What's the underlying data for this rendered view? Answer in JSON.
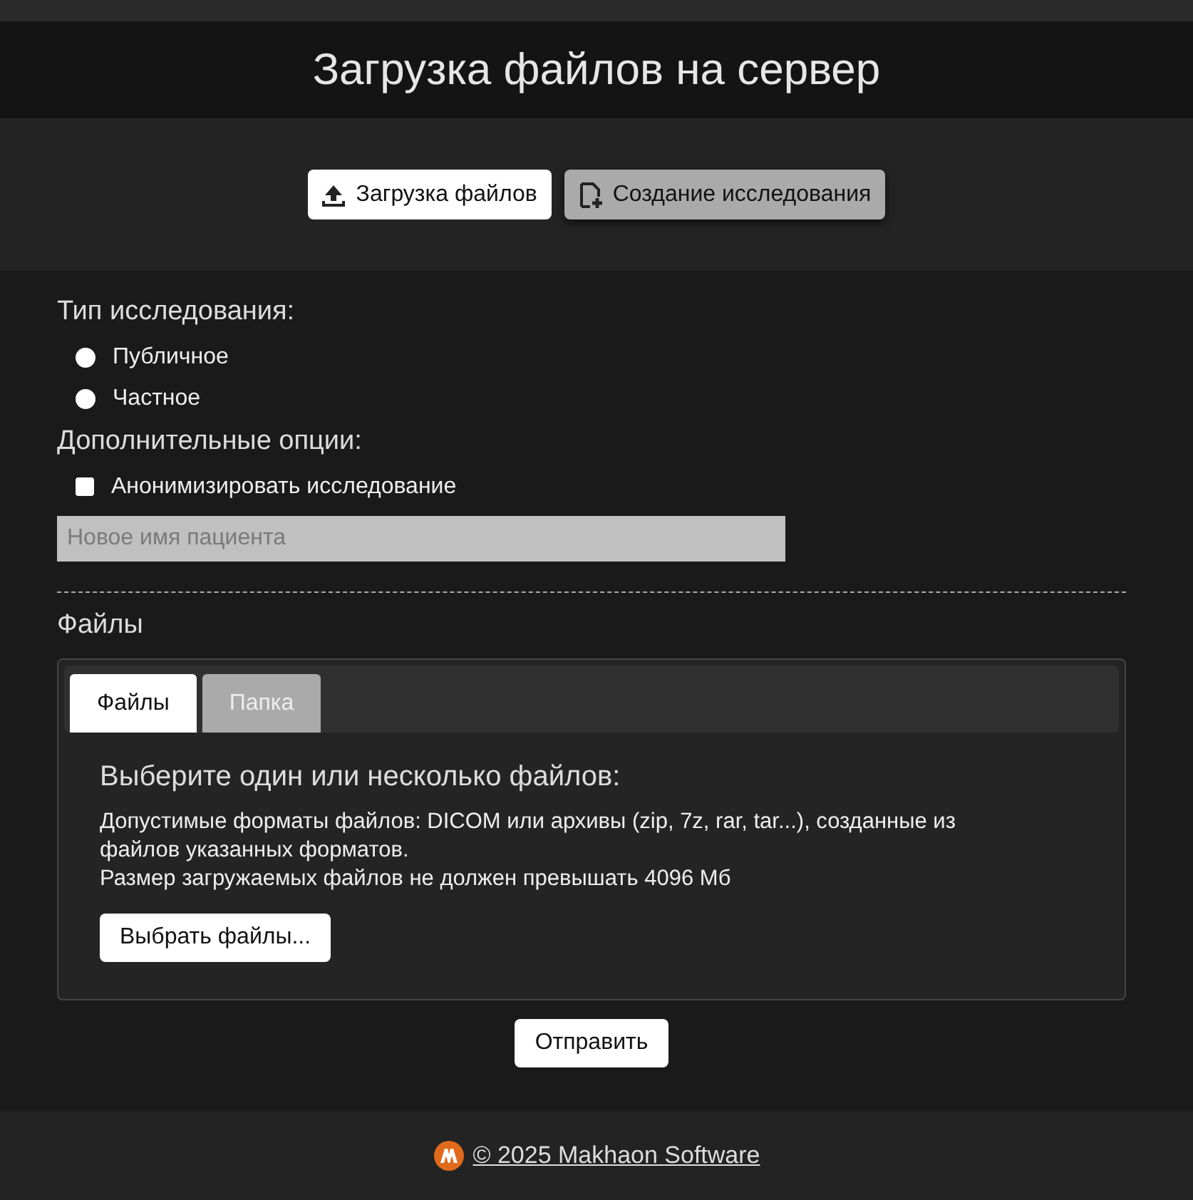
{
  "header": {
    "title": "Загрузка файлов на сервер"
  },
  "modes": [
    {
      "label": "Загрузка файлов",
      "selected": true
    },
    {
      "label": "Создание исследования",
      "selected": false
    }
  ],
  "study_type": {
    "heading": "Тип исследования:",
    "options": [
      {
        "label": "Публичное",
        "selected": false
      },
      {
        "label": "Частное",
        "selected": false
      }
    ]
  },
  "extra_options": {
    "heading": "Дополнительные опции:",
    "anonymize": {
      "label": "Анонимизировать исследование",
      "checked": false
    },
    "patient_name": {
      "placeholder": "Новое имя пациента"
    }
  },
  "files": {
    "heading": "Файлы",
    "tabs": [
      {
        "label": "Файлы",
        "selected": true
      },
      {
        "label": "Папка",
        "selected": false
      }
    ],
    "panel_title": "Выберите один или несколько файлов:",
    "notes": [
      "Допустимые форматы файлов: DICOM или архивы (zip, 7z, rar, tar...), созданные из файлов указанных форматов.",
      "Размер загружаемых файлов не должен превышать 4096 Мб"
    ],
    "choose_button": "Выбрать файлы..."
  },
  "submit_button": "Отправить",
  "footer": {
    "link": "© 2025 Makhaon Software"
  }
}
